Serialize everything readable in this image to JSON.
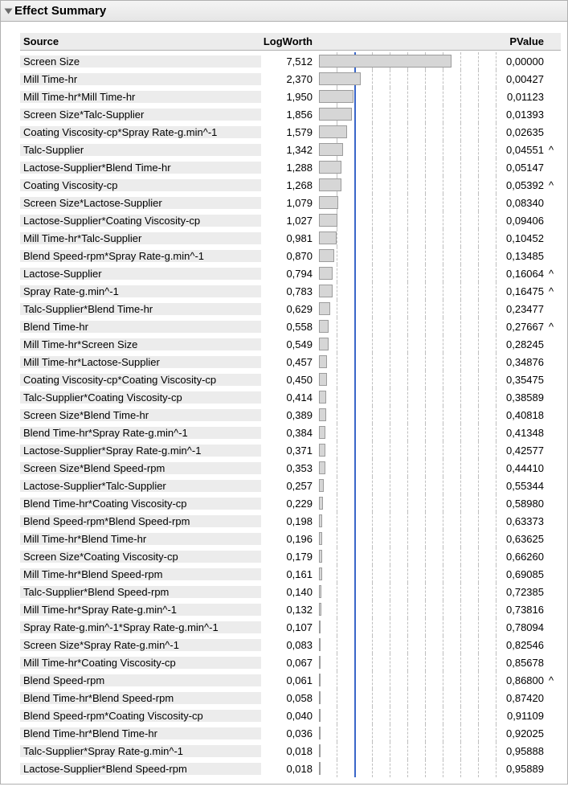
{
  "title": "Effect Summary",
  "columns": {
    "source": "Source",
    "logworth": "LogWorth",
    "pvalue": "PValue"
  },
  "chart_data": {
    "type": "bar",
    "title": "LogWorth",
    "xlabel": "LogWorth",
    "ylabel": "Source",
    "xlim": [
      0,
      10
    ],
    "ref_line": 2.0,
    "categories": [
      "Screen Size",
      "Mill Time-hr",
      "Mill Time-hr*Mill Time-hr",
      "Screen Size*Talc-Supplier",
      "Coating Viscosity-cp*Spray Rate-g.min^-1",
      "Talc-Supplier",
      "Lactose-Supplier*Blend Time-hr",
      "Coating Viscosity-cp",
      "Screen Size*Lactose-Supplier",
      "Lactose-Supplier*Coating Viscosity-cp",
      "Mill Time-hr*Talc-Supplier",
      "Blend Speed-rpm*Spray Rate-g.min^-1",
      "Lactose-Supplier",
      "Spray Rate-g.min^-1",
      "Talc-Supplier*Blend Time-hr",
      "Blend Time-hr",
      "Mill Time-hr*Screen Size",
      "Mill Time-hr*Lactose-Supplier",
      "Coating Viscosity-cp*Coating Viscosity-cp",
      "Talc-Supplier*Coating Viscosity-cp",
      "Screen Size*Blend Time-hr",
      "Blend Time-hr*Spray Rate-g.min^-1",
      "Lactose-Supplier*Spray Rate-g.min^-1",
      "Screen Size*Blend Speed-rpm",
      "Lactose-Supplier*Talc-Supplier",
      "Blend Time-hr*Coating Viscosity-cp",
      "Blend Speed-rpm*Blend Speed-rpm",
      "Mill Time-hr*Blend Time-hr",
      "Screen Size*Coating Viscosity-cp",
      "Mill Time-hr*Blend Speed-rpm",
      "Talc-Supplier*Blend Speed-rpm",
      "Mill Time-hr*Spray Rate-g.min^-1",
      "Spray Rate-g.min^-1*Spray Rate-g.min^-1",
      "Screen Size*Spray Rate-g.min^-1",
      "Mill Time-hr*Coating Viscosity-cp",
      "Blend Speed-rpm",
      "Blend Time-hr*Blend Speed-rpm",
      "Blend Speed-rpm*Coating Viscosity-cp",
      "Blend Time-hr*Blend Time-hr",
      "Talc-Supplier*Spray Rate-g.min^-1",
      "Lactose-Supplier*Blend Speed-rpm"
    ],
    "values": [
      7.512,
      2.37,
      1.95,
      1.856,
      1.579,
      1.342,
      1.288,
      1.268,
      1.079,
      1.027,
      0.981,
      0.87,
      0.794,
      0.783,
      0.629,
      0.558,
      0.549,
      0.457,
      0.45,
      0.414,
      0.389,
      0.384,
      0.371,
      0.353,
      0.257,
      0.229,
      0.198,
      0.196,
      0.179,
      0.161,
      0.14,
      0.132,
      0.107,
      0.083,
      0.067,
      0.061,
      0.058,
      0.04,
      0.036,
      0.018,
      0.018
    ]
  },
  "rows": [
    {
      "source": "Screen Size",
      "logworth": "7,512",
      "pvalue": "0,00000",
      "caret": ""
    },
    {
      "source": "Mill Time-hr",
      "logworth": "2,370",
      "pvalue": "0,00427",
      "caret": ""
    },
    {
      "source": "Mill Time-hr*Mill Time-hr",
      "logworth": "1,950",
      "pvalue": "0,01123",
      "caret": ""
    },
    {
      "source": "Screen Size*Talc-Supplier",
      "logworth": "1,856",
      "pvalue": "0,01393",
      "caret": ""
    },
    {
      "source": "Coating Viscosity-cp*Spray Rate-g.min^-1",
      "logworth": "1,579",
      "pvalue": "0,02635",
      "caret": ""
    },
    {
      "source": "Talc-Supplier",
      "logworth": "1,342",
      "pvalue": "0,04551",
      "caret": "^"
    },
    {
      "source": "Lactose-Supplier*Blend Time-hr",
      "logworth": "1,288",
      "pvalue": "0,05147",
      "caret": ""
    },
    {
      "source": "Coating Viscosity-cp",
      "logworth": "1,268",
      "pvalue": "0,05392",
      "caret": "^"
    },
    {
      "source": "Screen Size*Lactose-Supplier",
      "logworth": "1,079",
      "pvalue": "0,08340",
      "caret": ""
    },
    {
      "source": "Lactose-Supplier*Coating Viscosity-cp",
      "logworth": "1,027",
      "pvalue": "0,09406",
      "caret": ""
    },
    {
      "source": "Mill Time-hr*Talc-Supplier",
      "logworth": "0,981",
      "pvalue": "0,10452",
      "caret": ""
    },
    {
      "source": "Blend Speed-rpm*Spray Rate-g.min^-1",
      "logworth": "0,870",
      "pvalue": "0,13485",
      "caret": ""
    },
    {
      "source": "Lactose-Supplier",
      "logworth": "0,794",
      "pvalue": "0,16064",
      "caret": "^"
    },
    {
      "source": "Spray Rate-g.min^-1",
      "logworth": "0,783",
      "pvalue": "0,16475",
      "caret": "^"
    },
    {
      "source": "Talc-Supplier*Blend Time-hr",
      "logworth": "0,629",
      "pvalue": "0,23477",
      "caret": ""
    },
    {
      "source": "Blend Time-hr",
      "logworth": "0,558",
      "pvalue": "0,27667",
      "caret": "^"
    },
    {
      "source": "Mill Time-hr*Screen Size",
      "logworth": "0,549",
      "pvalue": "0,28245",
      "caret": ""
    },
    {
      "source": "Mill Time-hr*Lactose-Supplier",
      "logworth": "0,457",
      "pvalue": "0,34876",
      "caret": ""
    },
    {
      "source": "Coating Viscosity-cp*Coating Viscosity-cp",
      "logworth": "0,450",
      "pvalue": "0,35475",
      "caret": ""
    },
    {
      "source": "Talc-Supplier*Coating Viscosity-cp",
      "logworth": "0,414",
      "pvalue": "0,38589",
      "caret": ""
    },
    {
      "source": "Screen Size*Blend Time-hr",
      "logworth": "0,389",
      "pvalue": "0,40818",
      "caret": ""
    },
    {
      "source": "Blend Time-hr*Spray Rate-g.min^-1",
      "logworth": "0,384",
      "pvalue": "0,41348",
      "caret": ""
    },
    {
      "source": "Lactose-Supplier*Spray Rate-g.min^-1",
      "logworth": "0,371",
      "pvalue": "0,42577",
      "caret": ""
    },
    {
      "source": "Screen Size*Blend Speed-rpm",
      "logworth": "0,353",
      "pvalue": "0,44410",
      "caret": ""
    },
    {
      "source": "Lactose-Supplier*Talc-Supplier",
      "logworth": "0,257",
      "pvalue": "0,55344",
      "caret": ""
    },
    {
      "source": "Blend Time-hr*Coating Viscosity-cp",
      "logworth": "0,229",
      "pvalue": "0,58980",
      "caret": ""
    },
    {
      "source": "Blend Speed-rpm*Blend Speed-rpm",
      "logworth": "0,198",
      "pvalue": "0,63373",
      "caret": ""
    },
    {
      "source": "Mill Time-hr*Blend Time-hr",
      "logworth": "0,196",
      "pvalue": "0,63625",
      "caret": ""
    },
    {
      "source": "Screen Size*Coating Viscosity-cp",
      "logworth": "0,179",
      "pvalue": "0,66260",
      "caret": ""
    },
    {
      "source": "Mill Time-hr*Blend Speed-rpm",
      "logworth": "0,161",
      "pvalue": "0,69085",
      "caret": ""
    },
    {
      "source": "Talc-Supplier*Blend Speed-rpm",
      "logworth": "0,140",
      "pvalue": "0,72385",
      "caret": ""
    },
    {
      "source": "Mill Time-hr*Spray Rate-g.min^-1",
      "logworth": "0,132",
      "pvalue": "0,73816",
      "caret": ""
    },
    {
      "source": "Spray Rate-g.min^-1*Spray Rate-g.min^-1",
      "logworth": "0,107",
      "pvalue": "0,78094",
      "caret": ""
    },
    {
      "source": "Screen Size*Spray Rate-g.min^-1",
      "logworth": "0,083",
      "pvalue": "0,82546",
      "caret": ""
    },
    {
      "source": "Mill Time-hr*Coating Viscosity-cp",
      "logworth": "0,067",
      "pvalue": "0,85678",
      "caret": ""
    },
    {
      "source": "Blend Speed-rpm",
      "logworth": "0,061",
      "pvalue": "0,86800",
      "caret": "^"
    },
    {
      "source": "Blend Time-hr*Blend Speed-rpm",
      "logworth": "0,058",
      "pvalue": "0,87420",
      "caret": ""
    },
    {
      "source": "Blend Speed-rpm*Coating Viscosity-cp",
      "logworth": "0,040",
      "pvalue": "0,91109",
      "caret": ""
    },
    {
      "source": "Blend Time-hr*Blend Time-hr",
      "logworth": "0,036",
      "pvalue": "0,92025",
      "caret": ""
    },
    {
      "source": "Talc-Supplier*Spray Rate-g.min^-1",
      "logworth": "0,018",
      "pvalue": "0,95888",
      "caret": ""
    },
    {
      "source": "Lactose-Supplier*Blend Speed-rpm",
      "logworth": "0,018",
      "pvalue": "0,95889",
      "caret": ""
    }
  ]
}
